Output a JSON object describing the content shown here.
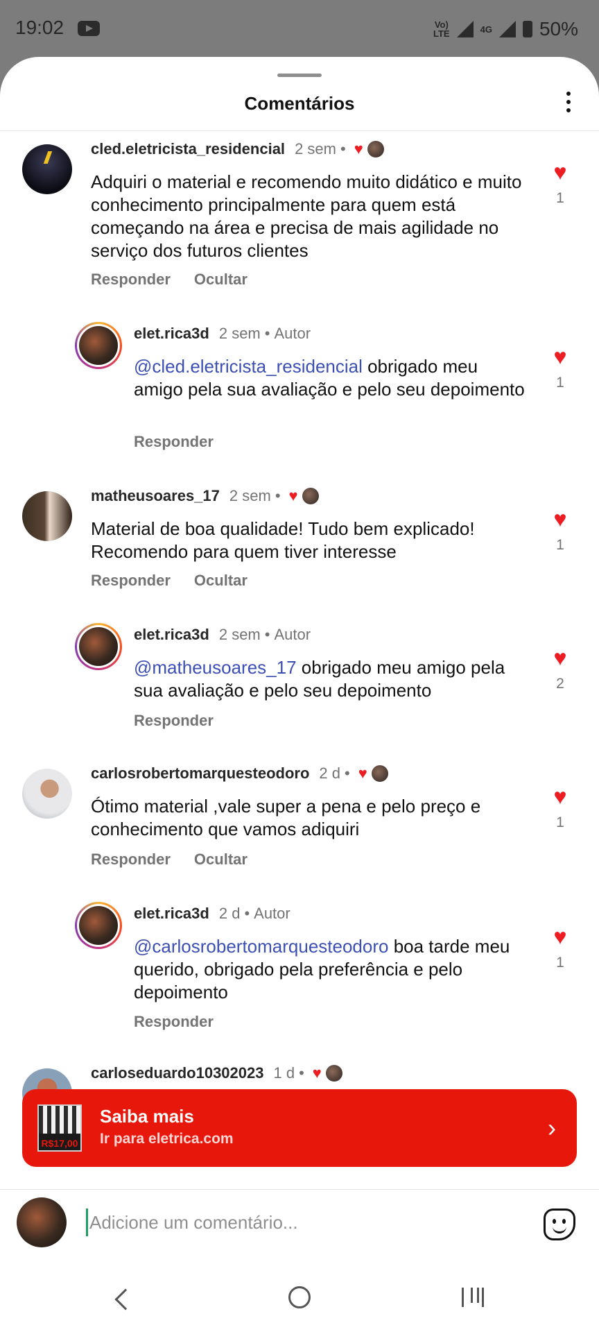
{
  "status": {
    "time": "19:02",
    "network_top": "Vo)",
    "network_bottom": "LTE",
    "net_type": "4G",
    "battery": "50%"
  },
  "header": {
    "title": "Comentários"
  },
  "comments": [
    {
      "username": "cled.eletricista_residencial",
      "time": "2 sem",
      "text": "Adquiri o material e recomendo muito didático e muito conhecimento principalmente para quem está começando na área e precisa de mais agilidade no serviço dos futuros clientes",
      "reply_label": "Responder",
      "hide_label": "Ocultar",
      "likes": "1",
      "reply": {
        "username": "elet.rica3d",
        "time": "2 sem",
        "author": "Autor",
        "mention": "@cled.eletricista_residencial",
        "text": " obrigado meu amigo pela sua avaliação e pelo seu depoimento",
        "reply_label": "Responder",
        "likes": "1"
      }
    },
    {
      "username": "matheusoares_17",
      "time": "2 sem",
      "text": "Material de boa qualidade! Tudo bem explicado! Recomendo para quem tiver interesse",
      "reply_label": "Responder",
      "hide_label": "Ocultar",
      "likes": "1",
      "reply": {
        "username": "elet.rica3d",
        "time": "2 sem",
        "author": "Autor",
        "mention": "@matheusoares_17",
        "text": " obrigado meu amigo pela sua avaliação e pelo seu depoimento",
        "reply_label": "Responder",
        "likes": "2"
      }
    },
    {
      "username": "carlosrobertomarquesteodoro",
      "time": "2 d",
      "text": "Ótimo material ,vale super a pena e pelo preço e conhecimento que vamos adiquiri",
      "reply_label": "Responder",
      "hide_label": "Ocultar",
      "likes": "1",
      "reply": {
        "username": "elet.rica3d",
        "time": "2 d",
        "author": "Autor",
        "mention": "@carlosrobertomarquesteodoro",
        "text": " boa tarde meu querido, obrigado pela preferência e pelo depoimento",
        "reply_label": "Responder",
        "likes": "1"
      }
    },
    {
      "username": "carloseduardo10302023",
      "time": "1 d"
    }
  ],
  "banner": {
    "title": "Saiba mais",
    "subtitle": "Ir para eletrica.com",
    "thumb_text": "R$17,00"
  },
  "composer": {
    "placeholder": "Adicione um comentário..."
  },
  "icons": {
    "heart": "heart-icon",
    "more": "more-vertical-icon",
    "sticker": "sticker-icon",
    "chevron": "chevron-right-icon"
  },
  "colors": {
    "accent_red": "#ed1d24",
    "banner_red": "#e8170b",
    "mention_blue": "#3c4fb5"
  }
}
